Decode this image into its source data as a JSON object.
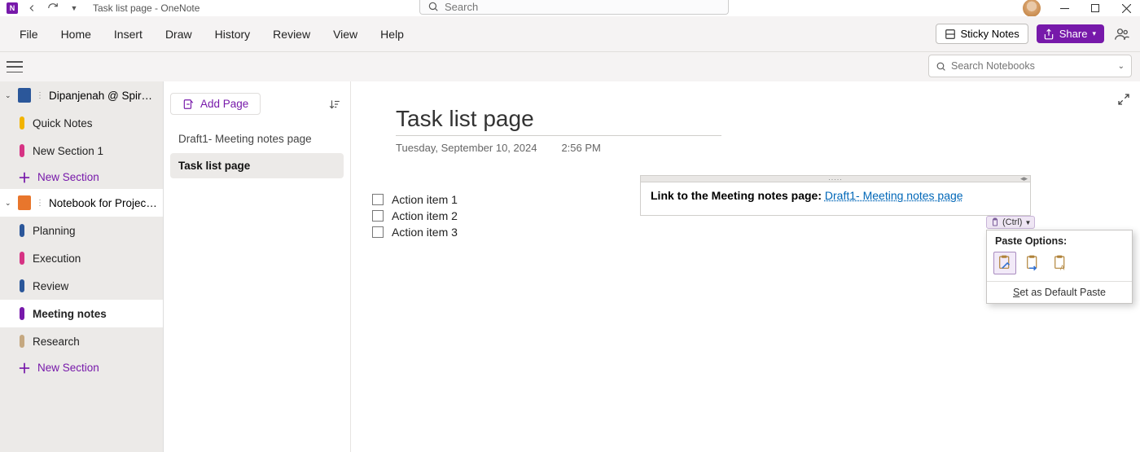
{
  "titlebar": {
    "title": "Task list page  -  OneNote",
    "search_placeholder": "Search"
  },
  "menubar": {
    "items": [
      "File",
      "Home",
      "Insert",
      "Draw",
      "History",
      "Review",
      "View",
      "Help"
    ],
    "sticky_label": "Sticky Notes",
    "share_label": "Share"
  },
  "subbar": {
    "nb_search_placeholder": "Search Notebooks"
  },
  "sidebar": {
    "notebooks": [
      {
        "name": "Dipanjenah @ Spiral...",
        "color": "#2b579a",
        "expanded": true,
        "sections": [
          {
            "label": "Quick Notes",
            "color": "#f2b400"
          },
          {
            "label": "New Section 1",
            "color": "#d63384"
          }
        ],
        "new_section_label": "New Section"
      },
      {
        "name": "Notebook for Project A",
        "color": "#e8762c",
        "expanded": true,
        "selected": true,
        "sections": [
          {
            "label": "Planning",
            "color": "#2b579a"
          },
          {
            "label": "Execution",
            "color": "#d63384"
          },
          {
            "label": "Review",
            "color": "#2b579a"
          },
          {
            "label": "Meeting notes",
            "color": "#7719aa",
            "active": true
          },
          {
            "label": "Research",
            "color": "#c5a880"
          }
        ],
        "new_section_label": "New Section"
      }
    ]
  },
  "pagelist": {
    "add_page_label": "Add Page",
    "pages": [
      {
        "label": "Draft1- Meeting notes page"
      },
      {
        "label": "Task list page",
        "active": true
      }
    ]
  },
  "canvas": {
    "title": "Task list page",
    "date": "Tuesday, September 10, 2024",
    "time": "2:56 PM",
    "tasks": [
      "Action item 1",
      "Action item 2",
      "Action item 3"
    ],
    "note_prefix": "Link to the Meeting notes page: ",
    "note_link_text": "Draft1- Meeting notes page"
  },
  "paste": {
    "ctrl_label": "(Ctrl)",
    "title": "Paste Options:",
    "set_default": "Set as Default Paste"
  }
}
